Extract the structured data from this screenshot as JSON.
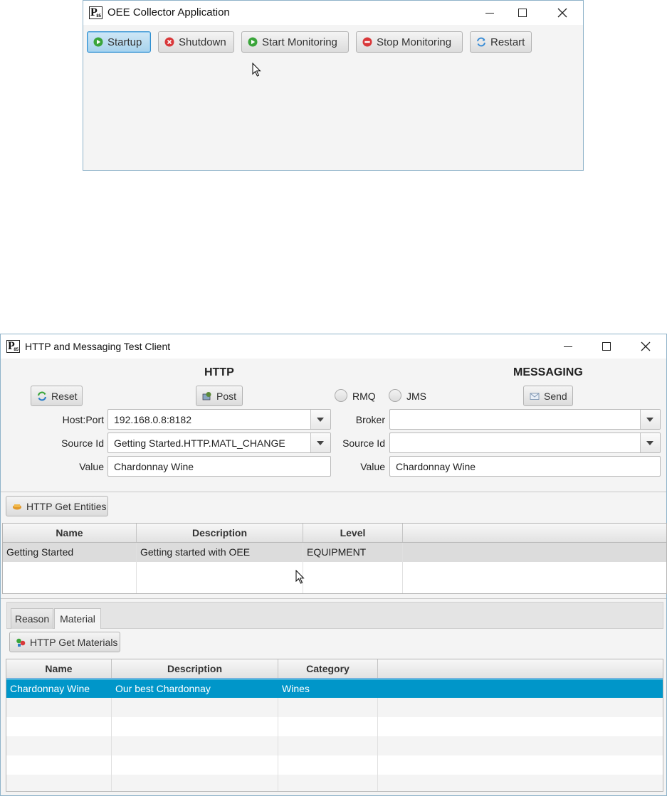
{
  "collector": {
    "title": "OEE Collector Application",
    "buttons": {
      "startup": "Startup",
      "shutdown": "Shutdown",
      "start_monitoring": "Start Monitoring",
      "stop_monitoring": "Stop Monitoring",
      "restart": "Restart"
    }
  },
  "client": {
    "title": "HTTP and Messaging Test Client",
    "http": {
      "heading": "HTTP",
      "reset_label": "Reset",
      "post_label": "Post",
      "host_port_label": "Host:Port",
      "host_port_value": "192.168.0.8:8182",
      "source_id_label": "Source Id",
      "source_id_value": "Getting Started.HTTP.MATL_CHANGE",
      "value_label": "Value",
      "value_value": "Chardonnay Wine"
    },
    "messaging": {
      "heading": "MESSAGING",
      "rmq_label": "RMQ",
      "jms_label": "JMS",
      "send_label": "Send",
      "broker_label": "Broker",
      "broker_value": "",
      "source_id_label": "Source Id",
      "source_id_value": "",
      "value_label": "Value",
      "value_value": "Chardonnay Wine"
    },
    "entities": {
      "button_label": "HTTP Get Entities",
      "columns": [
        "Name",
        "Description",
        "Level"
      ],
      "rows": [
        [
          "Getting Started",
          "Getting started with OEE",
          "EQUIPMENT"
        ]
      ]
    },
    "tabs": [
      {
        "label": "Reason",
        "active": false
      },
      {
        "label": "Material",
        "active": true
      }
    ],
    "materials": {
      "button_label": "HTTP Get Materials",
      "columns": [
        "Name",
        "Description",
        "Category"
      ],
      "rows": [
        [
          "Chardonnay Wine",
          "Our best Chardonnay",
          "Wines"
        ]
      ],
      "selection_color": "#0096c9"
    }
  },
  "colors": {
    "accent": "#2f8fd0",
    "start_green": "#3aa53a",
    "stop_red": "#d9383a"
  }
}
